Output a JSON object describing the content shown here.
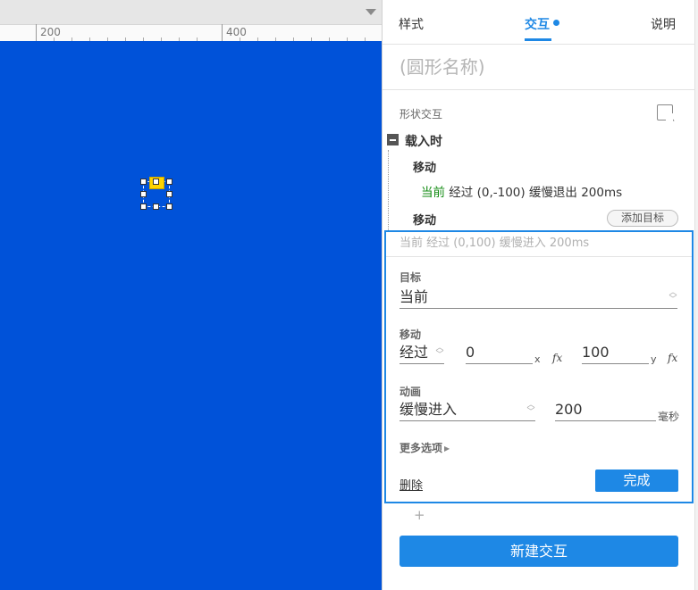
{
  "ruler": {
    "labels": [
      "200",
      "400"
    ],
    "dropdown_icon": "chevron-down-icon"
  },
  "canvas": {
    "background": "#0052d9",
    "widget_icon": "lightning-icon"
  },
  "tabs": {
    "style": "样式",
    "interaction": "交互",
    "notes": "说明",
    "active_color": "#1e88e5"
  },
  "shape_name_placeholder": "(圆形名称)",
  "interactions": {
    "section_title": "形状交互",
    "section_icon": "select-target-icon",
    "event": "载入时",
    "actions": [
      {
        "title": "移动",
        "target": "当前",
        "description": "经过 (0,-100) 缓慢退出 200ms"
      },
      {
        "title": "移动",
        "add_target_label": "添加目标"
      }
    ]
  },
  "editor": {
    "summary": "当前 经过 (0,100) 缓慢进入 200ms",
    "target_label": "目标",
    "target_value": "当前",
    "move_label": "移动",
    "move_mode": "经过",
    "x_value": "0",
    "x_axis": "x",
    "y_value": "100",
    "y_axis": "y",
    "fx_label": "fx",
    "animation_label": "动画",
    "animation_value": "缓慢进入",
    "duration_value": "200",
    "duration_unit": "毫秒",
    "more_options": "更多选项",
    "delete_label": "删除",
    "done_label": "完成"
  },
  "add_plus": "+",
  "new_interaction_label": "新建交互"
}
